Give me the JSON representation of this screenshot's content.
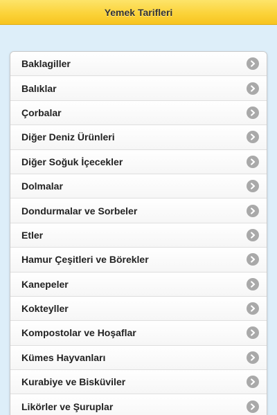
{
  "header": {
    "title": "Yemek Tarifleri"
  },
  "colors": {
    "header_bg": "#fbd33a",
    "page_bg": "#ddeef9",
    "arrow_bg": "#a9a9a9",
    "text": "#222222"
  },
  "list": {
    "items": [
      {
        "label": "Baklagiller",
        "icon": "chevron-right-icon"
      },
      {
        "label": "Balıklar",
        "icon": "chevron-right-icon"
      },
      {
        "label": "Çorbalar",
        "icon": "chevron-right-icon"
      },
      {
        "label": "Diğer Deniz Ürünleri",
        "icon": "chevron-right-icon"
      },
      {
        "label": "Diğer Soğuk İçecekler",
        "icon": "chevron-right-icon"
      },
      {
        "label": "Dolmalar",
        "icon": "chevron-right-icon"
      },
      {
        "label": "Dondurmalar ve Sorbeler",
        "icon": "chevron-right-icon"
      },
      {
        "label": "Etler",
        "icon": "chevron-right-icon"
      },
      {
        "label": "Hamur Çeşitleri ve Börekler",
        "icon": "chevron-right-icon"
      },
      {
        "label": "Kanepeler",
        "icon": "chevron-right-icon"
      },
      {
        "label": "Kokteyller",
        "icon": "chevron-right-icon"
      },
      {
        "label": "Kompostolar ve Hoşaflar",
        "icon": "chevron-right-icon"
      },
      {
        "label": "Kümes Hayvanları",
        "icon": "chevron-right-icon"
      },
      {
        "label": "Kurabiye ve Bisküviler",
        "icon": "chevron-right-icon"
      },
      {
        "label": "Likörler ve Şuruplar",
        "icon": "chevron-right-icon"
      }
    ]
  }
}
